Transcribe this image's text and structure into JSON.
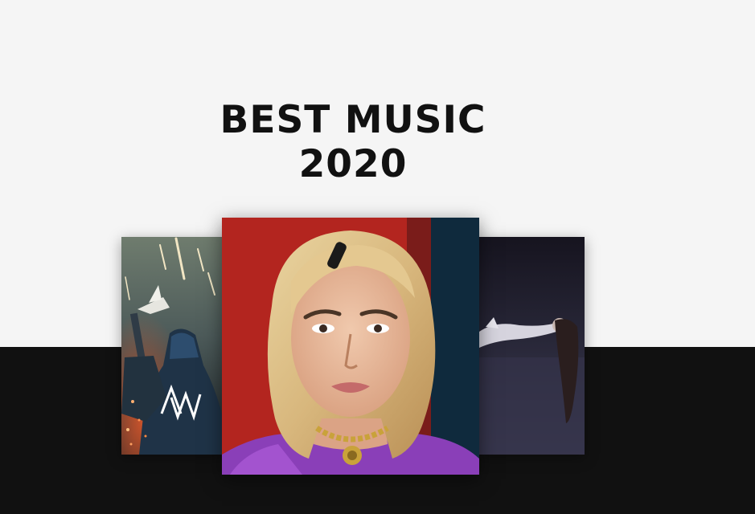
{
  "title": {
    "line1": "BEST MUSIC",
    "line2": "2020"
  },
  "covers": [
    {
      "position": "left",
      "artwork": "hooded-figure-with-meteors",
      "logo_icon": "aw-logo-icon"
    },
    {
      "position": "center",
      "artwork": "blonde-woman-portrait"
    },
    {
      "position": "right",
      "artwork": "levitating-woman-dark-room"
    }
  ],
  "colors": {
    "background_top": "#f5f5f5",
    "background_bottom": "#111111",
    "title": "#111111"
  }
}
